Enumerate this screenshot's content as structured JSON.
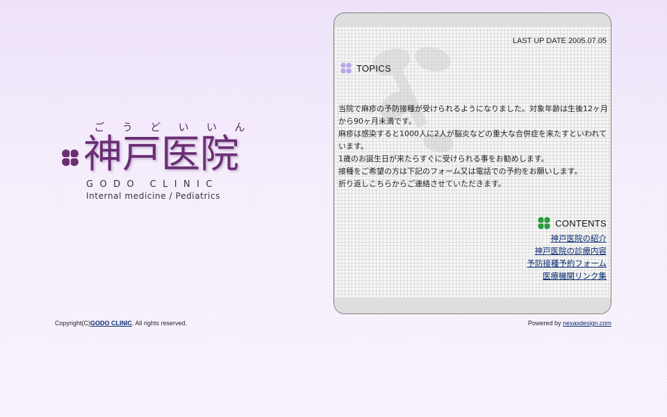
{
  "logo": {
    "ruby": [
      "ご",
      "う",
      "ど",
      "い",
      "い",
      "ん"
    ],
    "kanji": "神戸医院",
    "english": "GODO CLINIC",
    "subtitle": "Internal medicine / Pediatrics",
    "mark_icon": "clover-icon",
    "color": "#6a2f73"
  },
  "panel": {
    "update_text": "LAST UP DATE 2005.07.05",
    "topics": {
      "title": "TOPICS",
      "icon": "clover-icon",
      "icon_color": "#b9a8e8",
      "lines": [
        "当院で麻疹の予防接種が受けられるようになりました。対象年齢は生後12ヶ月から90ヶ月未満です。",
        "麻疹は感染すると1000人に2人が脳炎などの重大な合併症を来たすといわれています。",
        "1歳のお誕生日が来たらすぐに受けられる事をお勧めします。",
        "接種をご希望の方は下記のフォーム又は電話での予約をお願いします。",
        "折り返しこちらからご連絡させていただきます。"
      ]
    },
    "contents": {
      "title": "CONTENTS",
      "icon": "clover-icon",
      "icon_color": "#2e9a3e",
      "links": [
        "神戸医院の紹介",
        "神戸医院の診療内容",
        "予防接種予約フォーム",
        "医療機関リンク集"
      ]
    }
  },
  "footer": {
    "copyright_prefix": "Copyright(C)",
    "copyright_link": "GODO CLINIC",
    "copyright_suffix": ". All rights reserved.",
    "powered_prefix": "Powered by ",
    "powered_link": "nexasdesign.com",
    "link_color": "#0b2d73"
  }
}
